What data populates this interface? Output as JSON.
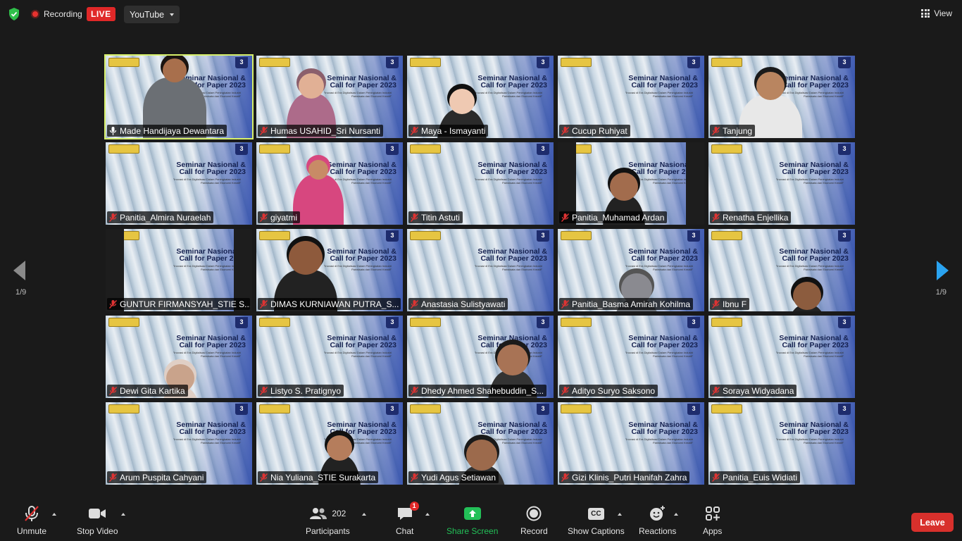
{
  "topbar": {
    "recording_label": "Recording",
    "live_badge": "LIVE",
    "stream_target": "YouTube",
    "view_label": "View"
  },
  "tile_banner": {
    "title_line1": "Seminar Nasional &",
    "title_line2": "Call for Paper 2023",
    "subtitle": "\"Inovasi di Era Digitalisasi Dalam Peningkatan Industri Pariwisata dan Ekonomi Kreatif\"",
    "badge": "3"
  },
  "participants": [
    {
      "name": "Made Handijaya Dewantara",
      "active": true
    },
    {
      "name": "Humas USAHID_Sri Nursanti"
    },
    {
      "name": "Maya - Ismayanti"
    },
    {
      "name": "Cucup Ruhiyat"
    },
    {
      "name": "Tanjung"
    },
    {
      "name": "Panitia_Almira Nuraelah"
    },
    {
      "name": "giyatmi"
    },
    {
      "name": "Titin Astuti"
    },
    {
      "name": "Panitia_Muhamad Ardan"
    },
    {
      "name": "Renatha Enjellika"
    },
    {
      "name": "GUNTUR FIRMANSYAH_STIE S..."
    },
    {
      "name": "DIMAS KURNIAWAN PUTRA_S..."
    },
    {
      "name": "Anastasia Sulistyawati"
    },
    {
      "name": "Panitia_Basma Amirah Kohilma"
    },
    {
      "name": "Ibnu F"
    },
    {
      "name": "Dewi Gita Kartika"
    },
    {
      "name": "Listyo S. Pratignyo"
    },
    {
      "name": "Dhedy Ahmed Shahebuddin_S..."
    },
    {
      "name": "Adityo Suryo Saksono"
    },
    {
      "name": "Soraya Widyadana"
    },
    {
      "name": "Arum Puspita Cahyani"
    },
    {
      "name": "Nia Yuliana_STIE Surakarta"
    },
    {
      "name": "Yudi Agus Setiawan"
    },
    {
      "name": "Gizi Klinis_Putri Hanifah Zahra"
    },
    {
      "name": "Panitia_Euis Widiati"
    }
  ],
  "pagination": {
    "left": "1/9",
    "right": "1/9"
  },
  "toolbar": {
    "unmute": "Unmute",
    "stop_video": "Stop Video",
    "participants": "Participants",
    "participant_count": "202",
    "chat": "Chat",
    "chat_badge": "1",
    "share_screen": "Share Screen",
    "record": "Record",
    "show_captions": "Show Captions",
    "captions_icon_text": "CC",
    "reactions": "Reactions",
    "apps": "Apps",
    "leave": "Leave"
  },
  "colors": {
    "active_speaker_border": "#d7f06a",
    "share_screen_green": "#23c058",
    "leave_red": "#d8302c",
    "live_red": "#e02828",
    "next_arrow_blue": "#2aa3f0"
  }
}
